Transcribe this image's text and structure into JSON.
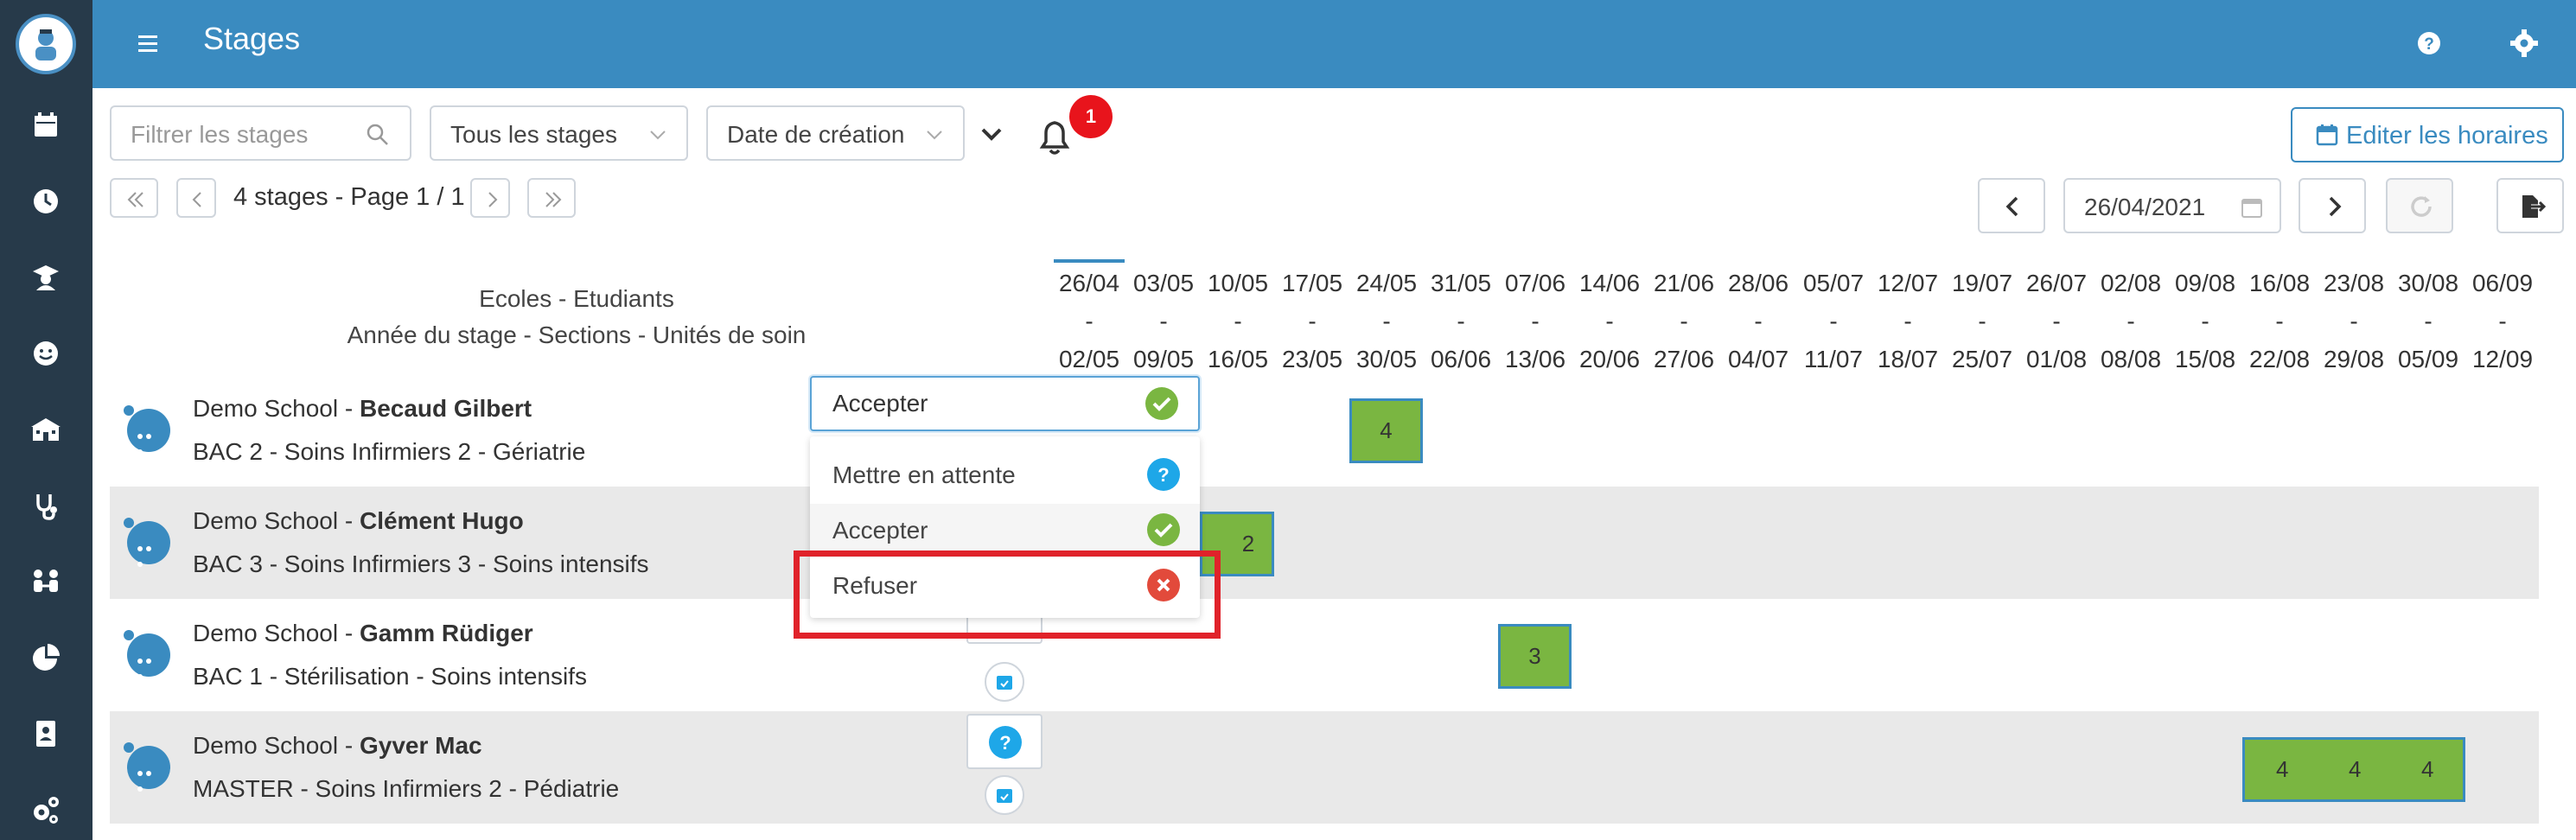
{
  "app": {
    "title": "Stages"
  },
  "sidebar": {
    "icons": [
      "logo-icon",
      "calendar-icon",
      "clock-icon",
      "graduate-icon",
      "smile-icon",
      "school-icon",
      "stethoscope-icon",
      "people-icon",
      "pie-chart-icon",
      "contact-card-icon",
      "settings-gears-icon"
    ]
  },
  "toolbar": {
    "filter_placeholder": "Filtrer les stages",
    "stages_filter": "Tous les stages",
    "sort_by": "Date de création",
    "notification_count": "1",
    "edit_schedule_label": "Editer les horaires",
    "pagination_text": "4 stages - Page 1 / 1",
    "date_value": "26/04/2021"
  },
  "header": {
    "line1": "Ecoles - Etudiants",
    "line2": "Année du stage - Sections - Unités de soin"
  },
  "weeks": [
    {
      "start": "26/04",
      "end": "02/05"
    },
    {
      "start": "03/05",
      "end": "09/05"
    },
    {
      "start": "10/05",
      "end": "16/05"
    },
    {
      "start": "17/05",
      "end": "23/05"
    },
    {
      "start": "24/05",
      "end": "30/05"
    },
    {
      "start": "31/05",
      "end": "06/06"
    },
    {
      "start": "07/06",
      "end": "13/06"
    },
    {
      "start": "14/06",
      "end": "20/06"
    },
    {
      "start": "21/06",
      "end": "27/06"
    },
    {
      "start": "28/06",
      "end": "04/07"
    },
    {
      "start": "05/07",
      "end": "11/07"
    },
    {
      "start": "12/07",
      "end": "18/07"
    },
    {
      "start": "19/07",
      "end": "25/07"
    },
    {
      "start": "26/07",
      "end": "01/08"
    },
    {
      "start": "02/08",
      "end": "08/08"
    },
    {
      "start": "09/08",
      "end": "15/08"
    },
    {
      "start": "16/08",
      "end": "22/08"
    },
    {
      "start": "23/08",
      "end": "29/08"
    },
    {
      "start": "30/08",
      "end": "05/09"
    },
    {
      "start": "06/09",
      "end": "12/09"
    }
  ],
  "week_separator": "-",
  "students": [
    {
      "school": "Demo School - ",
      "name": "Becaud Gilbert",
      "details": "BAC 2 - Soins Infirmiers 2 - Gériatrie",
      "cells": [
        "4"
      ]
    },
    {
      "school": "Demo School - ",
      "name": "Clément Hugo",
      "details": "BAC 3 - Soins Infirmiers 3 - Soins intensifs",
      "cells": [
        "2"
      ]
    },
    {
      "school": "Demo School - ",
      "name": "Gamm Rüdiger",
      "details": "BAC 1 - Stérilisation - Soins intensifs",
      "cells": [
        "3"
      ]
    },
    {
      "school": "Demo School - ",
      "name": "Gyver Mac",
      "details": "MASTER - Soins Infirmiers 2 - Pédiatrie",
      "cells": [
        "4",
        "4",
        "4"
      ]
    }
  ],
  "status_dropdown": {
    "selected": "Accepter",
    "options": [
      {
        "label": "Mettre en attente",
        "color": "#1ea7e8",
        "icon": "question-icon"
      },
      {
        "label": "Accepter",
        "color": "#7ab641",
        "icon": "check-icon"
      },
      {
        "label": "Refuser",
        "color": "#e24a3b",
        "icon": "close-icon"
      }
    ]
  },
  "colors": {
    "topbar": "#3a8bc0",
    "sidebar": "#273a4a",
    "cell_green": "#7ab641",
    "highlight_red": "#e0222a",
    "badge_red": "#e8141c"
  }
}
